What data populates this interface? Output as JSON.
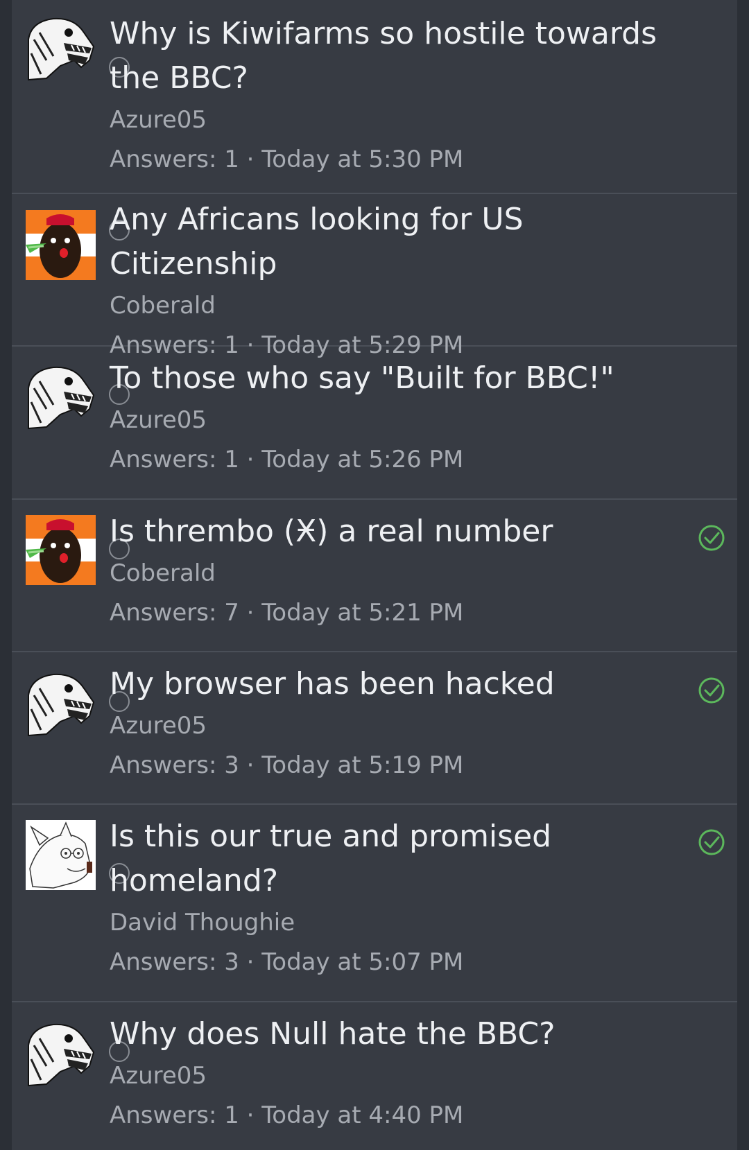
{
  "threads": [
    {
      "title": "Why is Kiwifarms so hostile towards the BBC?",
      "author": "Azure05",
      "answers_label": "Answers: 1",
      "separator": "·",
      "time": "Today at 5:30 PM",
      "avatar": "skull-avatar",
      "solved": false
    },
    {
      "title": "Any Africans looking for US Citizenship",
      "author": "Coberald",
      "answers_label": "Answers: 1",
      "separator": "·",
      "time": "Today at 5:29 PM",
      "avatar": "flag-face-avatar",
      "solved": false
    },
    {
      "title": "To those who say \"Built for BBC!\"",
      "author": "Azure05",
      "answers_label": "Answers: 1",
      "separator": "·",
      "time": "Today at 5:26 PM",
      "avatar": "skull-avatar",
      "solved": false
    },
    {
      "title": "Is thrembo (Ӿ) a real number",
      "author": "Coberald",
      "answers_label": "Answers: 7",
      "separator": "·",
      "time": "Today at 5:21 PM",
      "avatar": "flag-face-avatar",
      "solved": true
    },
    {
      "title": "My browser has been hacked",
      "author": "Azure05",
      "answers_label": "Answers: 3",
      "separator": "·",
      "time": "Today at 5:19 PM",
      "avatar": "skull-avatar",
      "solved": true
    },
    {
      "title": "Is this our true and promised homeland?",
      "author": "David Thoughie",
      "answers_label": "Answers: 3",
      "separator": "·",
      "time": "Today at 5:07 PM",
      "avatar": "dog-sketch-avatar",
      "solved": true
    },
    {
      "title": "Why does Null hate the BBC?",
      "author": "Azure05",
      "answers_label": "Answers: 1",
      "separator": "·",
      "time": "Today at 4:40 PM",
      "avatar": "skull-avatar",
      "solved": false
    }
  ],
  "colors": {
    "background": "#373b43",
    "title": "#eef0f3",
    "muted": "#a7abb2",
    "solved": "#5cb85c",
    "divider": "#4a4f58"
  }
}
